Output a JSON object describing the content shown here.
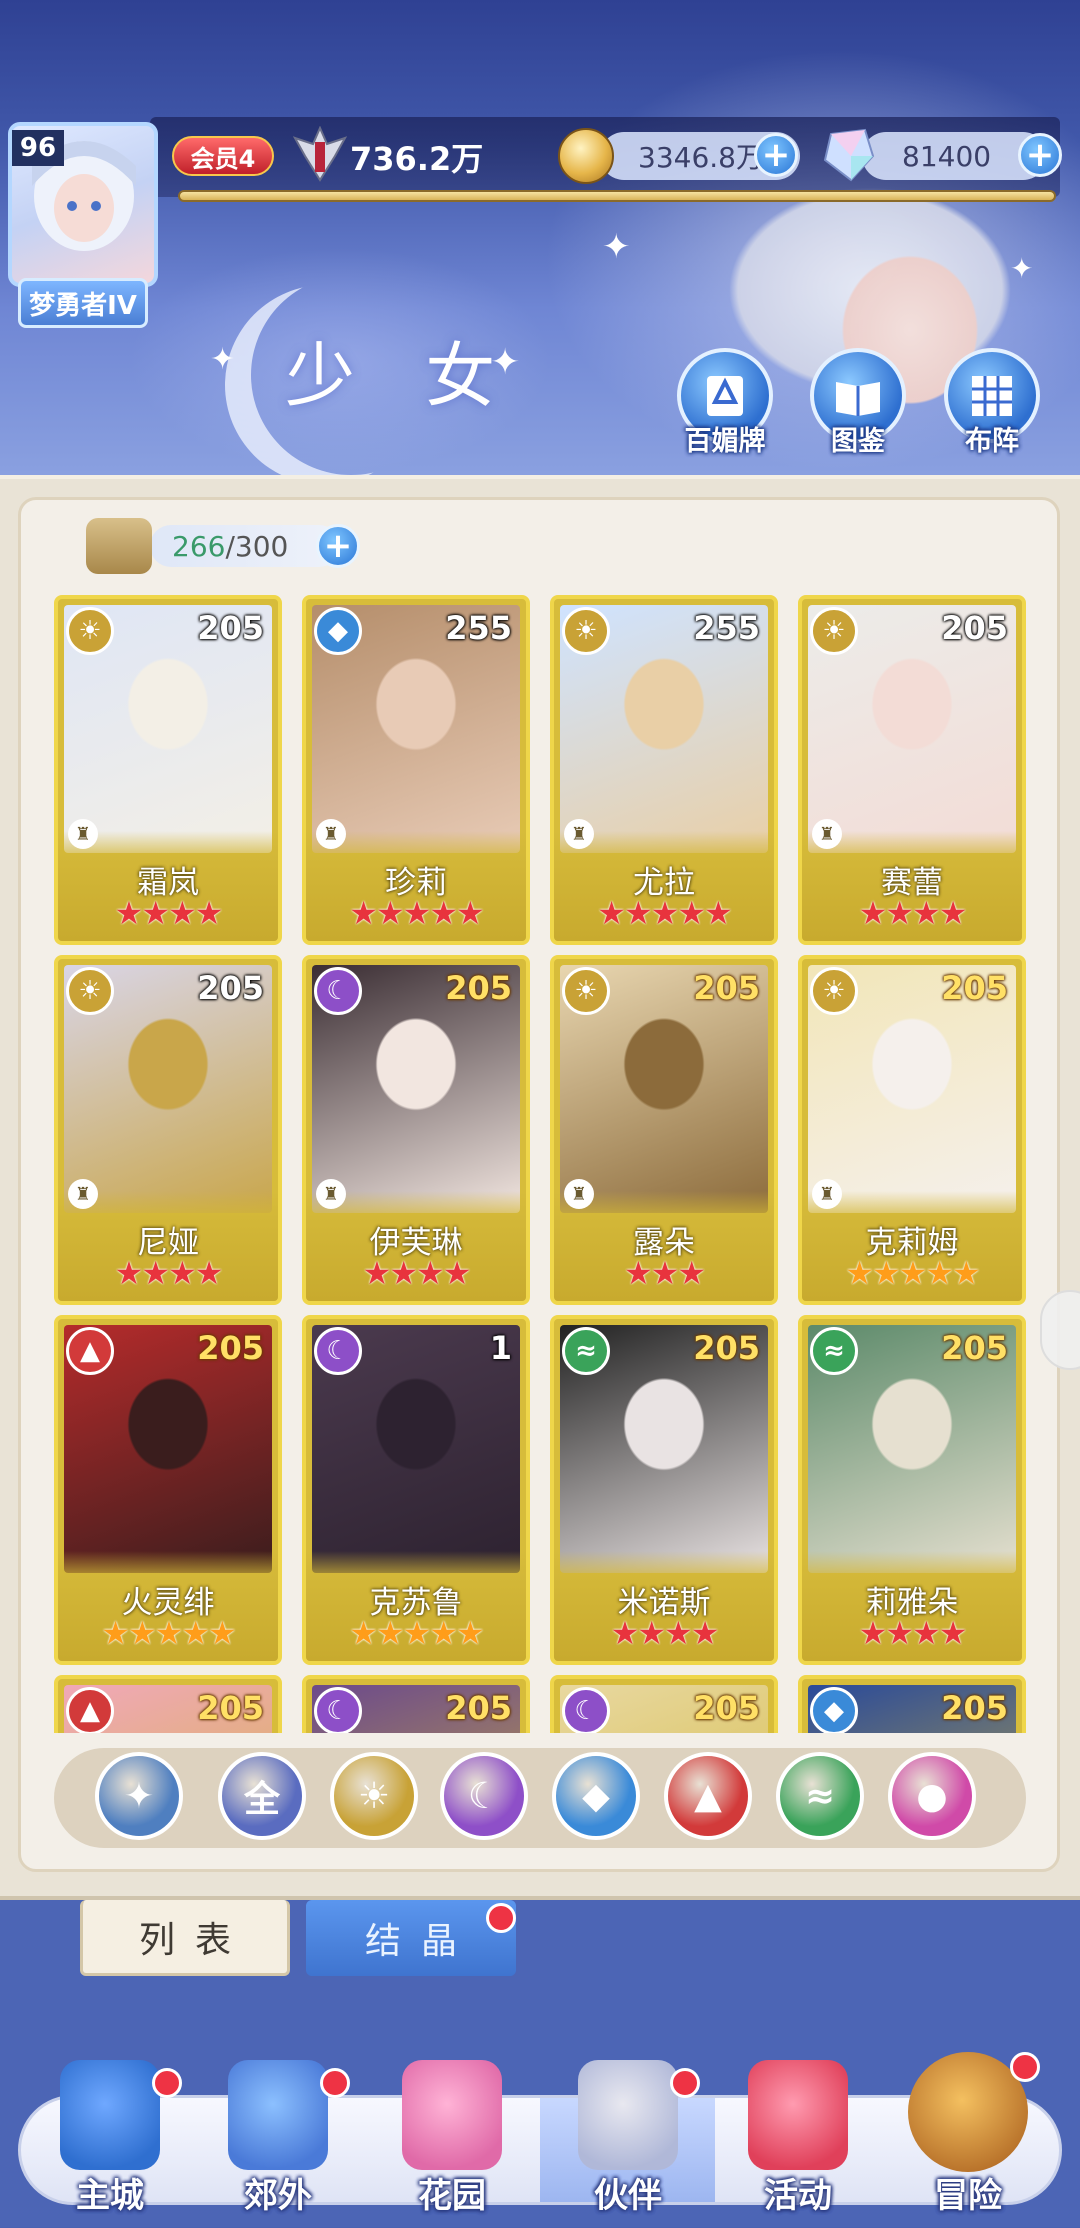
{
  "header": {
    "title": "少 女",
    "player": {
      "level": "96",
      "rank": "梦勇者IV"
    },
    "vip": "会员4",
    "power": "736.2万",
    "gold": "3346.8万",
    "gems": "81400",
    "buttons": [
      {
        "label": "百媚牌",
        "icon": "card-deck-icon"
      },
      {
        "label": "图鉴",
        "icon": "book-icon"
      },
      {
        "label": "布阵",
        "icon": "formation-grid-icon"
      }
    ]
  },
  "capacity": {
    "current": "266",
    "max": "/300"
  },
  "cards": [
    {
      "name": "霜岚",
      "level": "205",
      "element": "sun",
      "stars": "★★★★",
      "star_color": "red",
      "art": [
        "#dfe6f5",
        "#f3efe6"
      ]
    },
    {
      "name": "珍莉",
      "level": "255",
      "element": "water",
      "stars": "★★★★★",
      "star_color": "red",
      "art": [
        "#b58e6b",
        "#e8cbb6"
      ]
    },
    {
      "name": "尤拉",
      "level": "255",
      "element": "sun",
      "stars": "★★★★★",
      "star_color": "red",
      "art": [
        "#cfe3ff",
        "#e9cfa6"
      ]
    },
    {
      "name": "赛蕾",
      "level": "205",
      "element": "sun",
      "stars": "★★★★",
      "star_color": "red",
      "art": [
        "#ecece9",
        "#f3dcd6"
      ]
    },
    {
      "name": "尼娅",
      "level": "205",
      "element": "sun",
      "stars": "★★★★",
      "star_color": "red",
      "art": [
        "#d9d5e6",
        "#c9a64a"
      ]
    },
    {
      "name": "伊芙琳",
      "level": "205",
      "element": "moon",
      "stars": "★★★★",
      "star_color": "red",
      "art": [
        "#3a2d33",
        "#f2e6e0"
      ]
    },
    {
      "name": "露朵",
      "level": "205",
      "element": "sun",
      "stars": "★★★",
      "star_color": "red",
      "art": [
        "#e8d6b0",
        "#8c6b3b"
      ]
    },
    {
      "name": "克莉姆",
      "level": "205",
      "element": "sun",
      "stars": "★★★★★",
      "star_color": "orange",
      "art": [
        "#f2e6b8",
        "#f5f0ec"
      ]
    },
    {
      "name": "火灵绯",
      "level": "205",
      "element": "fire",
      "stars": "★★★★★",
      "star_color": "orange",
      "art": [
        "#b52b2b",
        "#3a1d1d"
      ]
    },
    {
      "name": "克苏鲁",
      "level": "1",
      "element": "moon",
      "stars": "★★★★★",
      "star_color": "orange",
      "art": [
        "#4b3a4e",
        "#2d2230"
      ]
    },
    {
      "name": "米诺斯",
      "level": "205",
      "element": "wind",
      "stars": "★★★★",
      "star_color": "red",
      "art": [
        "#222222",
        "#e9e3e3"
      ]
    },
    {
      "name": "莉雅朵",
      "level": "205",
      "element": "wind",
      "stars": "★★★★",
      "star_color": "red",
      "art": [
        "#5c8a6a",
        "#e6e0d0"
      ]
    },
    {
      "name": "",
      "level": "205",
      "element": "fire",
      "stars": "",
      "star_color": "red",
      "art": [
        "#f0a8b8",
        "#d2b637"
      ]
    },
    {
      "name": "",
      "level": "205",
      "element": "moon",
      "stars": "",
      "star_color": "red",
      "art": [
        "#6c4a8c",
        "#d2b637"
      ]
    },
    {
      "name": "",
      "level": "205",
      "element": "moon",
      "stars": "",
      "star_color": "red",
      "art": [
        "#e8d8a0",
        "#d2b637"
      ]
    },
    {
      "name": "",
      "level": "205",
      "element": "water",
      "stars": "",
      "star_color": "red",
      "art": [
        "#2a4a9a",
        "#d2b637"
      ]
    }
  ],
  "filters": [
    {
      "id": "role",
      "label": "",
      "icon": "star-class-icon",
      "color": "#4f7fc0"
    },
    {
      "id": "all",
      "label": "全",
      "icon": "all-icon",
      "color": "#5a6cc0"
    },
    {
      "id": "sun",
      "label": "",
      "icon": "sun-icon",
      "color": "#c8a236"
    },
    {
      "id": "moon",
      "label": "",
      "icon": "moon-icon",
      "color": "#8e4fc8"
    },
    {
      "id": "water",
      "label": "",
      "icon": "water-drop-icon",
      "color": "#3a8ad8"
    },
    {
      "id": "fire",
      "label": "",
      "icon": "fire-icon",
      "color": "#d23a3a"
    },
    {
      "id": "wind",
      "label": "",
      "icon": "wind-icon",
      "color": "#3aa35a"
    },
    {
      "id": "special",
      "label": "",
      "icon": "orb-icon",
      "color": "#d04aa8"
    }
  ],
  "tabs": {
    "list": "列表",
    "crystal": "结晶"
  },
  "nav": [
    {
      "label": "主城",
      "art": [
        "#6fa8ff",
        "#2f6fd0"
      ],
      "badge": true
    },
    {
      "label": "郊外",
      "art": [
        "#8cc0ff",
        "#4a7ad8"
      ],
      "badge": true
    },
    {
      "label": "花园",
      "art": [
        "#ffb3d6",
        "#e06aa8"
      ],
      "badge": false
    },
    {
      "label": "伙伴",
      "art": [
        "#e8e8f0",
        "#b0b8d8"
      ],
      "badge": true
    },
    {
      "label": "活动",
      "art": [
        "#ff9bb0",
        "#e0405a"
      ],
      "badge": false
    },
    {
      "label": "冒险",
      "art": [
        "#f4c060",
        "#b8722a"
      ],
      "badge": true
    }
  ],
  "element_colors": {
    "sun": "#c9a236",
    "moon": "#8d4fc8",
    "water": "#3a8ad8",
    "fire": "#d23a3a",
    "wind": "#3aa35a"
  }
}
